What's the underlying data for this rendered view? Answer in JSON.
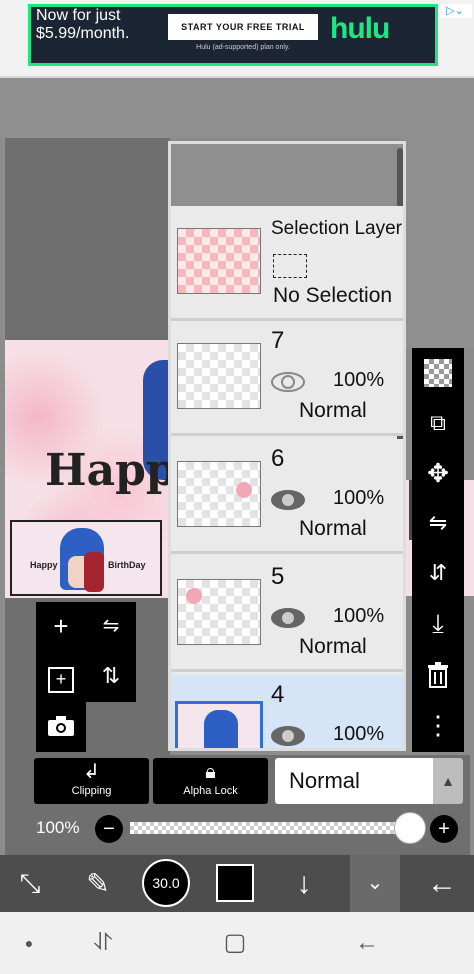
{
  "ad": {
    "headline": "Now for just $5.99/month.",
    "cta": "START YOUR FREE TRIAL",
    "fine_print": "Hulu (ad-supported) plan only.",
    "brand": "hulu",
    "info_icon": "adchoices-icon",
    "brand_color": "#1ce783"
  },
  "artwork": {
    "text": "Happy",
    "thumbnail_text_left": "Happy",
    "thumbnail_text_right": "BirthDay"
  },
  "layers": {
    "selection": {
      "name": "Selection Layer",
      "status": "No Selection"
    },
    "items": [
      {
        "number": "7",
        "opacity": "100%",
        "blend": "Normal"
      },
      {
        "number": "6",
        "opacity": "100%",
        "blend": "Normal"
      },
      {
        "number": "5",
        "opacity": "100%",
        "blend": "Normal"
      },
      {
        "number": "4",
        "opacity": "100%",
        "blend": ""
      }
    ]
  },
  "left_tools": {
    "add": "+",
    "flip": "⇋",
    "add_copy": "+",
    "merge": "⇅",
    "camera": "camera-icon"
  },
  "right_tools": [
    "checkerboard-icon",
    "transform-icon",
    "move-icon",
    "flip-horizontal-icon",
    "flip-vertical-icon",
    "merge-down-icon",
    "trash-icon",
    "more-icon"
  ],
  "controls": {
    "clipping_label": "Clipping",
    "alpha_lock_label": "Alpha Lock",
    "blend_mode": "Normal",
    "opacity_label": "100%",
    "opacity_value": 1.0
  },
  "toolbar": {
    "brush_size": "30.0",
    "current_color": "#000000"
  }
}
